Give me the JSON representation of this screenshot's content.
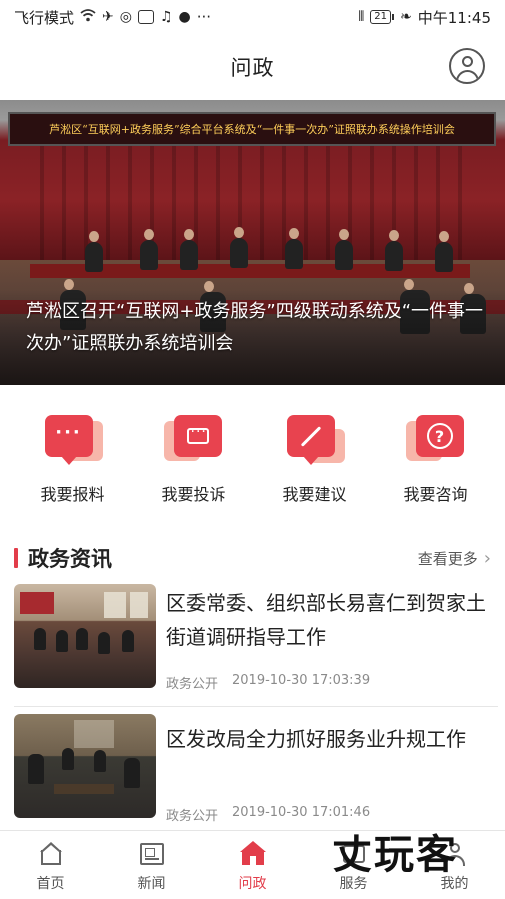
{
  "status_bar": {
    "left_text": "飞行模式",
    "more": "···",
    "battery": "21",
    "time": "中午11:45"
  },
  "header": {
    "title": "问政"
  },
  "banner": {
    "sign_text": "芦淞区“互联网+政务服务”综合平台系统及“一件事一次办”证照联办系统操作培训会",
    "caption": "芦淞区召开“互联网+政务服务”四级联动系统及“一件事一次办”证照联办系统培训会",
    "slide_count": 3,
    "active_slide": 1
  },
  "actions": [
    {
      "label": "我要报料",
      "icon": "report-bubble-icon"
    },
    {
      "label": "我要投诉",
      "icon": "complaint-message-icon"
    },
    {
      "label": "我要建议",
      "icon": "suggestion-pen-icon"
    },
    {
      "label": "我要咨询",
      "icon": "question-icon"
    }
  ],
  "section": {
    "title": "政务资讯",
    "more_label": "查看更多"
  },
  "news": [
    {
      "title": "区委常委、组织部长易喜仁到贺家土街道调研指导工作",
      "category": "政务公开",
      "datetime": "2019-10-30 17:03:39"
    },
    {
      "title": "区发改局全力抓好服务业升规工作",
      "category": "政务公开",
      "datetime": "2019-10-30 17:01:46"
    }
  ],
  "bottom_nav": [
    {
      "label": "首页",
      "icon": "home-icon",
      "active": false
    },
    {
      "label": "新闻",
      "icon": "news-icon",
      "active": false
    },
    {
      "label": "问政",
      "icon": "government-icon",
      "active": true
    },
    {
      "label": "服务",
      "icon": "service-icon",
      "active": false
    },
    {
      "label": "我的",
      "icon": "profile-icon",
      "active": false
    }
  ],
  "watermark": "丈玩客",
  "colors": {
    "accent": "#e23d4a",
    "icon_light": "#f7b6aa"
  }
}
